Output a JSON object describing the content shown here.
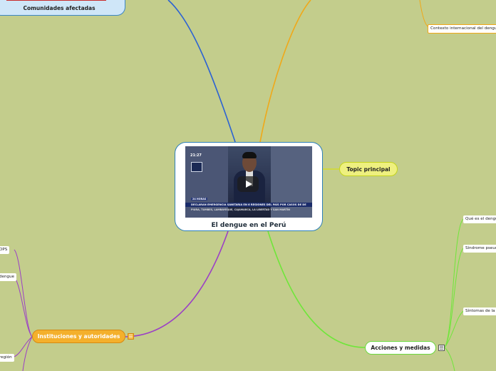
{
  "central": {
    "title": "El dengue en el Perú",
    "video": {
      "time": "21:27",
      "tag": "24 HORAS",
      "ticker": "DECLARAN EMERGENCIA SANITARIA EN 6 REGIONES DEL PAÍS POR CASOS DE DENGUE",
      "subticker": "PIURA, TUMBES, LAMBAYEQUE, CAJAMARCA, LA LIBERTAD Y SAN MARTÍN"
    }
  },
  "topic_principal": "Topic principal",
  "acciones": "Acciones y medidas",
  "instituciones": "Instituciones y autoridades",
  "comunidades": "Comunidades afectadas",
  "right_subtopics": [
    "Contexto internacional del dengue",
    "Qué es el dengue",
    "Síndrome pseudogripal",
    "Síntomas de la"
  ],
  "left_subtopics": [
    "OPS",
    "dengue",
    "región"
  ],
  "colors": {
    "background": "#c3cd8c",
    "blue_branch": "#2b62d4",
    "orange_branch": "#f0a818",
    "purple_branch": "#9b3fc6",
    "green_branch": "#6fe63a",
    "yellow_branch": "#d4dc2a"
  },
  "icons": {
    "menu": "menu-lines-icon",
    "play": "play-icon"
  }
}
